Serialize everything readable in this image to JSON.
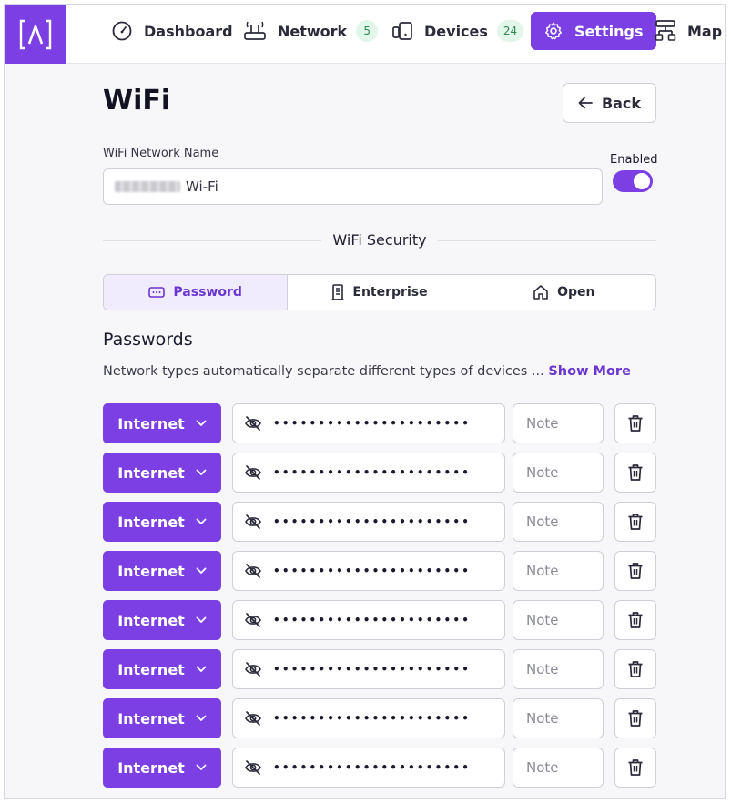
{
  "nav": {
    "items": [
      {
        "label": "Dashboard",
        "icon": "gauge-icon"
      },
      {
        "label": "Network",
        "icon": "router-icon",
        "badge": "5"
      },
      {
        "label": "Devices",
        "icon": "devices-icon",
        "badge": "24"
      },
      {
        "label": "Settings",
        "icon": "gear-icon",
        "active": true
      },
      {
        "label": "Map",
        "icon": "sitemap-icon"
      }
    ]
  },
  "page": {
    "title": "WiFi",
    "back_label": "Back"
  },
  "network": {
    "name_label": "WiFi Network Name",
    "name_value": "Wi-Fi",
    "enabled_label": "Enabled",
    "enabled": true
  },
  "security": {
    "heading": "WiFi Security",
    "options": [
      {
        "label": "Password",
        "icon": "password-icon",
        "selected": true
      },
      {
        "label": "Enterprise",
        "icon": "building-icon",
        "selected": false
      },
      {
        "label": "Open",
        "icon": "home-icon",
        "selected": false
      }
    ]
  },
  "passwords": {
    "heading": "Passwords",
    "description": "Network types automatically separate different types of devices ...",
    "show_more": "Show More",
    "note_placeholder": "Note",
    "rows": [
      {
        "type": "Internet",
        "masked": "••••••••••••••••••••••"
      },
      {
        "type": "Internet",
        "masked": "••••••••••••••••••••••"
      },
      {
        "type": "Internet",
        "masked": "••••••••••••••••••••••"
      },
      {
        "type": "Internet",
        "masked": "••••••••••••••••••••••"
      },
      {
        "type": "Internet",
        "masked": "••••••••••••••••••••••"
      },
      {
        "type": "Internet",
        "masked": "••••••••••••••••••••••"
      },
      {
        "type": "Internet",
        "masked": "••••••••••••••••••••••"
      },
      {
        "type": "Internet",
        "masked": "••••••••••••••••••••••"
      }
    ]
  },
  "colors": {
    "accent": "#7b3fe4",
    "badge_bg": "#e3f6ea",
    "badge_text": "#2f8a52"
  }
}
